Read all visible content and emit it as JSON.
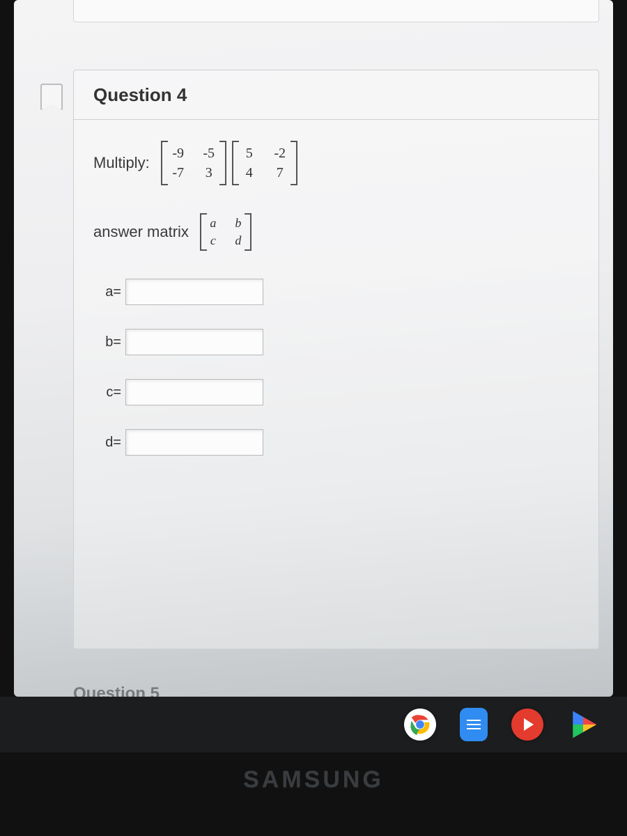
{
  "question": {
    "title": "Question 4",
    "prompt_label": "Multiply:",
    "matrix_a": [
      [
        "-9",
        "-5"
      ],
      [
        "-7",
        "3"
      ]
    ],
    "matrix_b": [
      [
        "5",
        "-2"
      ],
      [
        "4",
        "7"
      ]
    ],
    "answer_label": "answer matrix",
    "answer_matrix_vars": [
      [
        "a",
        "b"
      ],
      [
        "c",
        "d"
      ]
    ],
    "fields": [
      {
        "label": "a=",
        "value": ""
      },
      {
        "label": "b=",
        "value": ""
      },
      {
        "label": "c=",
        "value": ""
      },
      {
        "label": "d=",
        "value": ""
      }
    ],
    "next_title_peek": "Question 5"
  },
  "shelf": {
    "apps": [
      "chrome",
      "docs",
      "youtube",
      "play-store"
    ]
  },
  "device_brand": "SAMSUNG"
}
